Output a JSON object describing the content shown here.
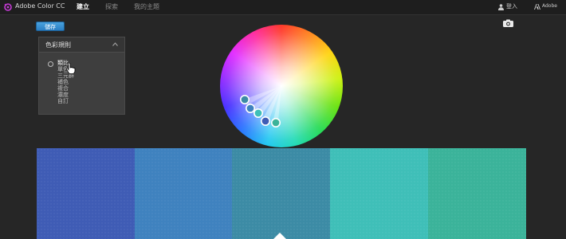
{
  "header": {
    "app_title": "Adobe Color CC",
    "nav": [
      {
        "label": "建立",
        "active": true
      },
      {
        "label": "探索",
        "active": false
      },
      {
        "label": "我的主題",
        "active": false
      }
    ],
    "signin_label": "登入",
    "adobe_label": "Adobe"
  },
  "toolbar": {
    "save_label": "儲存"
  },
  "rule_panel": {
    "title": "色彩規則",
    "items": [
      {
        "label": "類比",
        "selected": true
      },
      {
        "label": "單色",
        "selected": false
      },
      {
        "label": "三元群",
        "selected": false
      },
      {
        "label": "補色",
        "selected": false
      },
      {
        "label": "複合",
        "selected": false
      },
      {
        "label": "濃度",
        "selected": false
      },
      {
        "label": "自訂",
        "selected": false
      }
    ]
  },
  "swatches": [
    {
      "color": "#3f5cb5"
    },
    {
      "color": "#3f82bf"
    },
    {
      "color": "#3c8ba5"
    },
    {
      "color": "#3fbfb8"
    },
    {
      "color": "#3bb39a"
    }
  ],
  "colors": {
    "accent": "#2b7fc4",
    "background": "#262626"
  },
  "icons": [
    "logo-icon",
    "user-icon",
    "adobe-logo-icon",
    "camera-icon",
    "chevron-up-icon",
    "radio-icon",
    "hand-cursor-icon",
    "base-color-marker-icon"
  ]
}
